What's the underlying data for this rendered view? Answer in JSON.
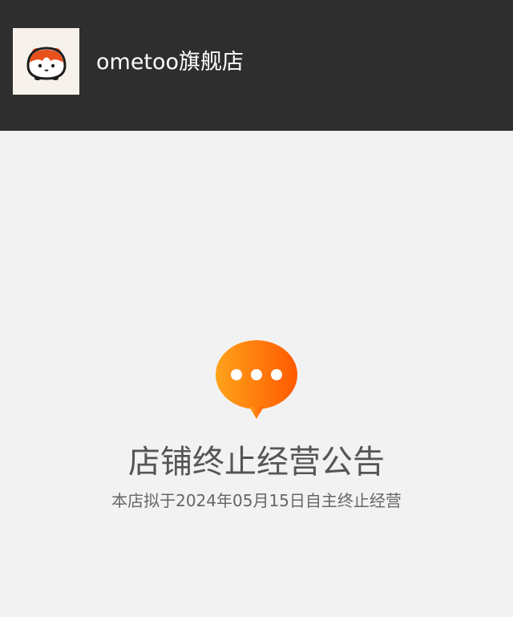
{
  "header": {
    "shop_name": "ometoo旗舰店",
    "logo_icon": "guinea-pig-logo-icon"
  },
  "notice": {
    "icon": "chat-bubble-dots-icon",
    "title": "店铺终止经营公告",
    "description": "本店拟于2024年05月15日自主终止经营"
  },
  "colors": {
    "header_bg": "#2e2e2e",
    "page_bg": "#f2f2f2",
    "accent_orange": "#ff6a00",
    "accent_orange_light": "#ffa21a"
  }
}
